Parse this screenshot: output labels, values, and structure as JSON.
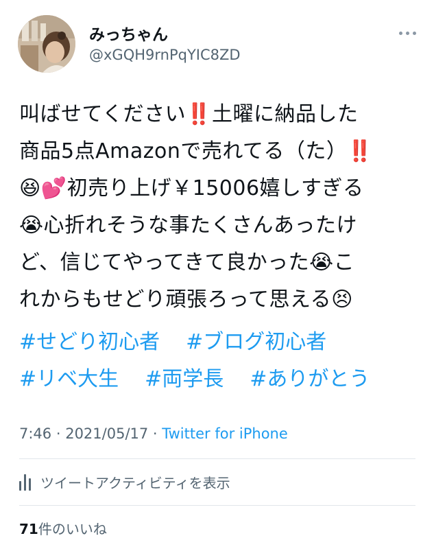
{
  "user": {
    "display_name": "みっちゃん",
    "handle": "@xGQH9rnPqYIC8ZD"
  },
  "tweet": {
    "lines": [
      "叫ばせてください‼️土曜に納品した",
      "商品5点Amazonで売れてる（た）‼️",
      "😆💕初売り上げ￥15006嬉しすぎる",
      "😭心折れそうな事たくさんあったけ",
      "ど、信じてやってきて良かった😭こ",
      "れからもせどり頑張ろって思える😣"
    ],
    "hashtags": [
      [
        "#せどり初心者",
        "#ブログ初心者"
      ],
      [
        "#リベ大生",
        "#両学長",
        "#ありがとう"
      ]
    ]
  },
  "meta": {
    "time": "7:46",
    "separator1": " · ",
    "date": "2021/05/17",
    "separator2": " · ",
    "source": "Twitter for iPhone"
  },
  "activity": {
    "label": "ツイートアクティビティを表示",
    "icon": "analytics-bars-icon"
  },
  "likes": {
    "count": "71",
    "label": "件のいいね"
  },
  "colors": {
    "link": "#1d9bf0",
    "secondary_text": "#536471",
    "primary_text": "#0f1419",
    "divider": "#e1e6ea"
  }
}
